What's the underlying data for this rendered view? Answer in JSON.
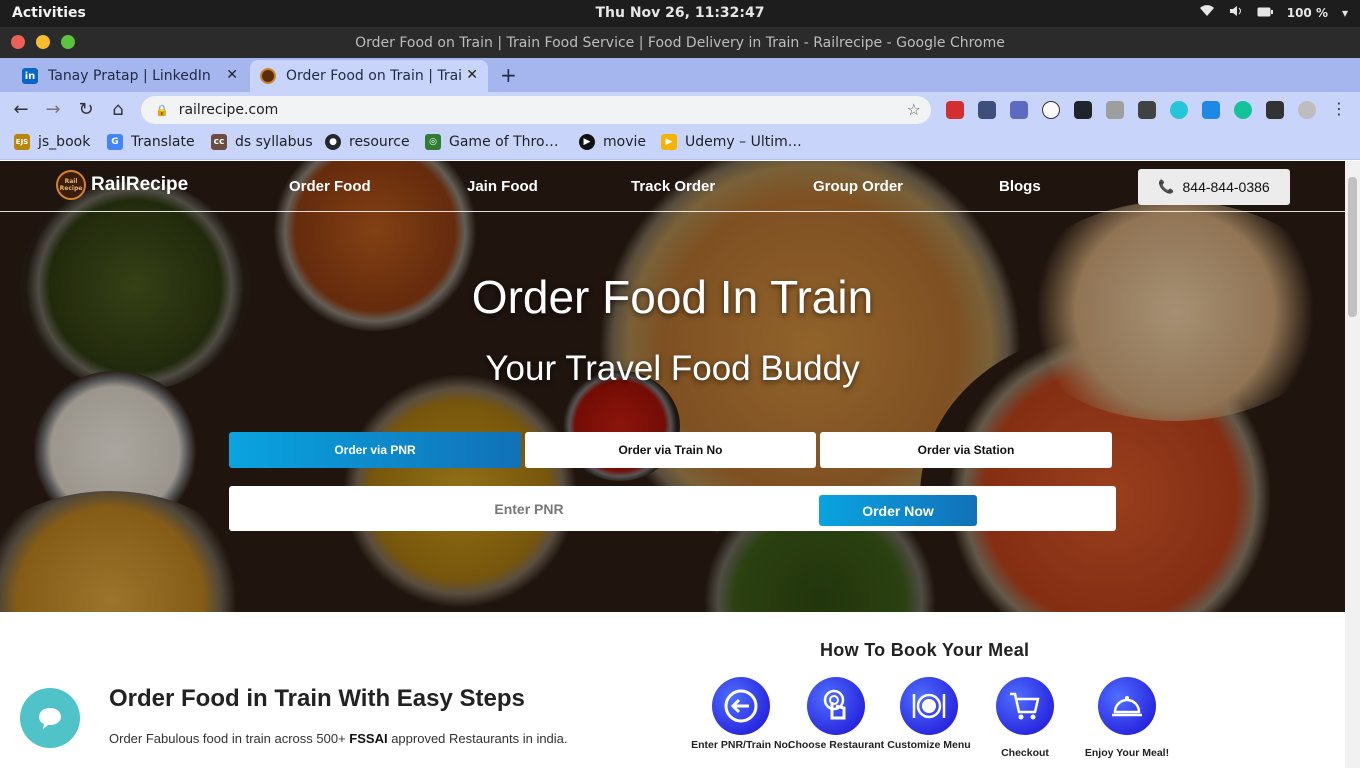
{
  "os": {
    "activities": "Activities",
    "clock": "Thu Nov 26, 11:32:47",
    "battery": "100 %"
  },
  "window": {
    "title": "Order Food on Train | Train Food Service | Food Delivery in Train - Railrecipe - Google Chrome"
  },
  "tabs": [
    {
      "label": "Tanay Pratap | LinkedIn",
      "favicon": "linkedin-icon",
      "color": "#0a66c2"
    },
    {
      "label": "Order Food on Train | Trai",
      "favicon": "railrecipe-icon",
      "color": "#5a2d0c"
    }
  ],
  "toolbar": {
    "url": "railrecipe.com"
  },
  "bookmarks": [
    {
      "label": "js_book",
      "icon": "EJS",
      "color": "#b8860b"
    },
    {
      "label": "Translate",
      "icon": "G",
      "color": "#4285f4"
    },
    {
      "label": "ds syllabus",
      "icon": "cc",
      "color": "#6d4c41"
    },
    {
      "label": "resource",
      "icon": "github-icon",
      "color": "#24292e"
    },
    {
      "label": "Game of Thro…",
      "icon": "globe-icon",
      "color": "#2e7d32"
    },
    {
      "label": "movie",
      "icon": "play-icon",
      "color": "#111111"
    },
    {
      "label": "Udemy – Ultim…",
      "icon": "udemy-icon",
      "color": "#f4b400"
    }
  ],
  "site": {
    "brand": "RailRecipe",
    "logo_text": "Rail Recipe",
    "nav": [
      "Order Food",
      "Jain Food",
      "Track Order",
      "Group Order",
      "Blogs"
    ],
    "phone": "844-844-0386",
    "hero_title": "Order Food In Train",
    "hero_subtitle": "Your Travel Food Buddy",
    "order_tabs": [
      "Order via PNR",
      "Order via Train No",
      "Order via Station"
    ],
    "pnr_placeholder": "Enter PNR",
    "order_now": "Order Now",
    "easy_title": "Order Food in Train With Easy Steps",
    "easy_text_pre": "Order Fabulous food in train across 500+ ",
    "easy_text_bold": "FSSAI",
    "easy_text_post": " approved Restaurants in india.",
    "how_title": "How To Book Your Meal",
    "steps": [
      {
        "label": "Enter PNR/Train No.",
        "icon": "enter-icon"
      },
      {
        "label": "Choose Restaurant",
        "icon": "touch-icon"
      },
      {
        "label": "Customize Menu",
        "icon": "plate-icon"
      },
      {
        "label": "Checkout",
        "icon": "cart-icon"
      },
      {
        "label": "Enjoy Your Meal!",
        "icon": "cloche-icon"
      }
    ],
    "accent": "#09a4e0",
    "step_color": "#2a2ae0"
  }
}
